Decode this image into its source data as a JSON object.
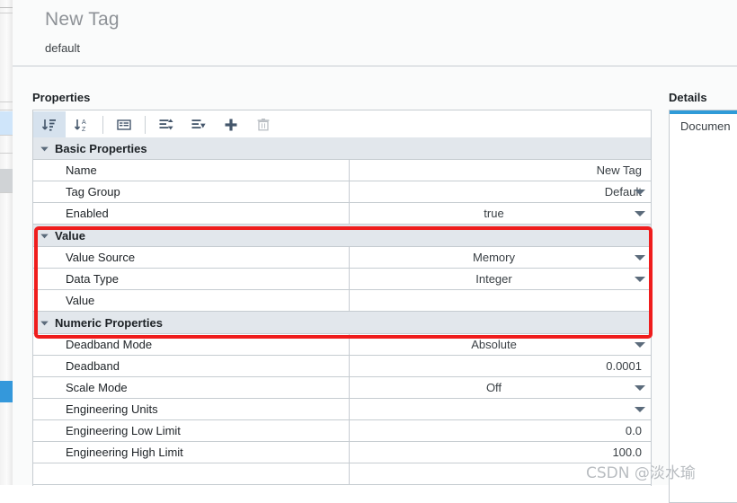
{
  "header": {
    "title": "New Tag",
    "subtitle": "default"
  },
  "properties_panel": {
    "label": "Properties",
    "toolbar": [
      {
        "name": "sort-by-category-icon",
        "tip": "Sort by Category",
        "active": true
      },
      {
        "name": "sort-alphabetical-icon",
        "tip": "Sort Alphabetically",
        "active": false
      },
      {
        "name": "show-description-icon",
        "tip": "Show Description",
        "active": false
      },
      {
        "name": "expand-all-icon",
        "tip": "Expand All",
        "active": false
      },
      {
        "name": "collapse-all-icon",
        "tip": "Collapse All",
        "active": false
      },
      {
        "name": "add-icon",
        "tip": "Add",
        "active": false
      },
      {
        "name": "delete-icon",
        "tip": "Delete",
        "active": false,
        "disabled": true
      }
    ],
    "rows": [
      {
        "kind": "group",
        "label": "Basic Properties"
      },
      {
        "kind": "prop",
        "label": "Name",
        "value": "New Tag",
        "align": "right",
        "caret": false
      },
      {
        "kind": "prop",
        "label": "Tag Group",
        "value": "Default",
        "align": "right",
        "caret": true
      },
      {
        "kind": "prop",
        "label": "Enabled",
        "value": "true",
        "align": "center",
        "caret": true
      },
      {
        "kind": "group",
        "label": "Value"
      },
      {
        "kind": "prop",
        "label": "Value Source",
        "value": "Memory",
        "align": "center",
        "caret": true
      },
      {
        "kind": "prop",
        "label": "Data Type",
        "value": "Integer",
        "align": "center",
        "caret": true
      },
      {
        "kind": "prop",
        "label": "Value",
        "value": "",
        "align": "right",
        "caret": false
      },
      {
        "kind": "group",
        "label": "Numeric Properties"
      },
      {
        "kind": "prop",
        "label": "Deadband Mode",
        "value": "Absolute",
        "align": "center",
        "caret": true
      },
      {
        "kind": "prop",
        "label": "Deadband",
        "value": "0.0001",
        "align": "right",
        "caret": false
      },
      {
        "kind": "prop",
        "label": "Scale Mode",
        "value": "Off",
        "align": "center",
        "caret": true
      },
      {
        "kind": "prop",
        "label": "Engineering Units",
        "value": "",
        "align": "center",
        "caret": true
      },
      {
        "kind": "prop",
        "label": "Engineering Low Limit",
        "value": "0.0",
        "align": "right",
        "caret": false
      },
      {
        "kind": "prop",
        "label": "Engineering High Limit",
        "value": "100.0",
        "align": "right",
        "caret": false
      },
      {
        "kind": "prop",
        "label": "",
        "value": "",
        "align": "right",
        "caret": false
      }
    ],
    "scrollbar": {
      "up_arrow": "scroll-up-arrow"
    }
  },
  "details_panel": {
    "label": "Details",
    "tab": "Documen",
    "accent_color": "#2f9bd8"
  },
  "annotation": {
    "highlight_color": "#ef1d1d"
  },
  "watermark": {
    "text": "CSDN @淡水瑜"
  }
}
